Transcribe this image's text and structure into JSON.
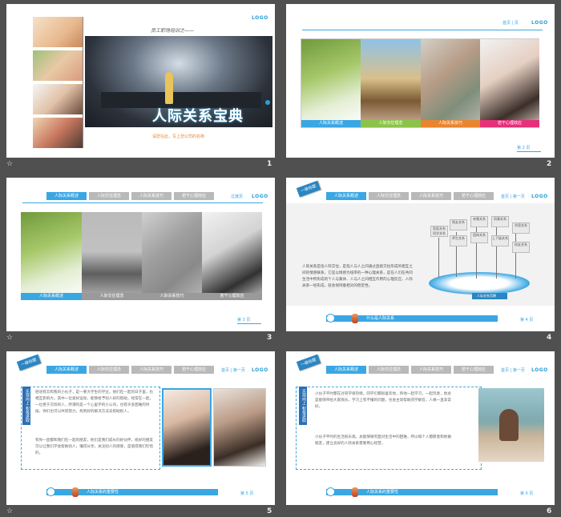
{
  "slides": [
    {
      "number": "1",
      "subtitle": "员工职场培训之——",
      "title": "人际关系宝典",
      "tagline": "请您在此，写上您公司的名称",
      "logo": "LOGO"
    },
    {
      "number": "2",
      "nav_links": "首页 | 页",
      "logo": "LOGO",
      "captions": [
        "人际关系概述",
        "人际交往理念",
        "人际关系技巧",
        "若干心理效应"
      ],
      "page_label": "第 2 页"
    },
    {
      "number": "3",
      "nav_links": "过渡页",
      "logo": "LOGO",
      "nav": [
        "人际关系概述",
        "人际交往理念",
        "人际关系技巧",
        "若干心理效应"
      ],
      "captions": [
        "人际关系概述",
        "人际交往理念",
        "人际关系技巧",
        "若干心理效应"
      ],
      "page_label": "第 3 页"
    },
    {
      "number": "4",
      "tag": "一级标题",
      "nav_links": "首页 | 第一页",
      "logo": "LOGO",
      "nav": [
        "人际关系概述",
        "人际交往理念",
        "人际关系技巧",
        "若干心理效应"
      ],
      "body": "人际关系是指人际交往，是指人与人之间通过直接交往形成的相互之间的情感联系，它是以情感为纽带的一种心理关系，是在人们在共同生活中所形成的个人与集体、人与人之间相互作用的心理反应，人际关系一经形成，就会保持着相对的稳定性。",
      "signs": [
        "家庭关系 同学关系",
        "朋友关系",
        "亲属关系",
        "同事关系",
        "邻里关系",
        "师生关系",
        "团体关系",
        "上下级关系",
        "校友关系",
        "对手关系"
      ],
      "platform_label": "人际关系范畴",
      "footer": "什么是人际关系",
      "page_label": "第 4 页"
    },
    {
      "number": "5",
      "tag": "一级标题",
      "nav_links": "首页 | 第一页",
      "logo": "LOGO",
      "nav": [
        "人际关系概述",
        "人际交往理念",
        "人际关系技巧",
        "若干心理效应"
      ],
      "ribbon": "乐观向上 积极进取",
      "body": "俗语有云和我的小伙子，是一要大学生的学业，他们在一起的日子里，也相互影响大。其中一位爱好运动，能够给予别人好的帮助，经常在一起，一位善于交际的人，所谓的是一个心里学的小公司，也有许多困难的时候，你们也可以共同努力，找到好的解决方法去帮助别人。",
      "body2": "有你一直都和我们在一起的朋友，他们是我们成长的好伙伴，很好的朋友可以让我们学会帮助别人，懂得分享，关注别人的感受，是值得我们珍惜的。",
      "footer": "人际关系的重要性",
      "page_label": "第 5 页"
    },
    {
      "number": "6",
      "tag": "一级标题",
      "nav_links": "首页 | 第一页",
      "logo": "LOGO",
      "nav": [
        "人际关系概述",
        "人际交往理念",
        "人际关系技巧",
        "若干心理效应"
      ],
      "ribbon": "乐观向上 积极进取",
      "body": "小伙子平时都在对同学很热情，同学们都很喜欢他，和他一起学习，一起玩耍，他总是能够带给大家快乐，学习上有不懂的问题，也会主动帮助同学解答，人缘一直非常好。",
      "body2": "小伙子平时的生活很乐观，总能够微笑面对生活中的困难，所以每个人都愿意和他做朋友，建立良好的人际关系需要用心经营。",
      "footer": "人际关系的重要性",
      "page_label": "第 6 页"
    }
  ],
  "star": "☆",
  "colors": {
    "accent": "#3aa7e3",
    "dark_accent": "#2b6fb5",
    "orange": "#e9852f"
  }
}
